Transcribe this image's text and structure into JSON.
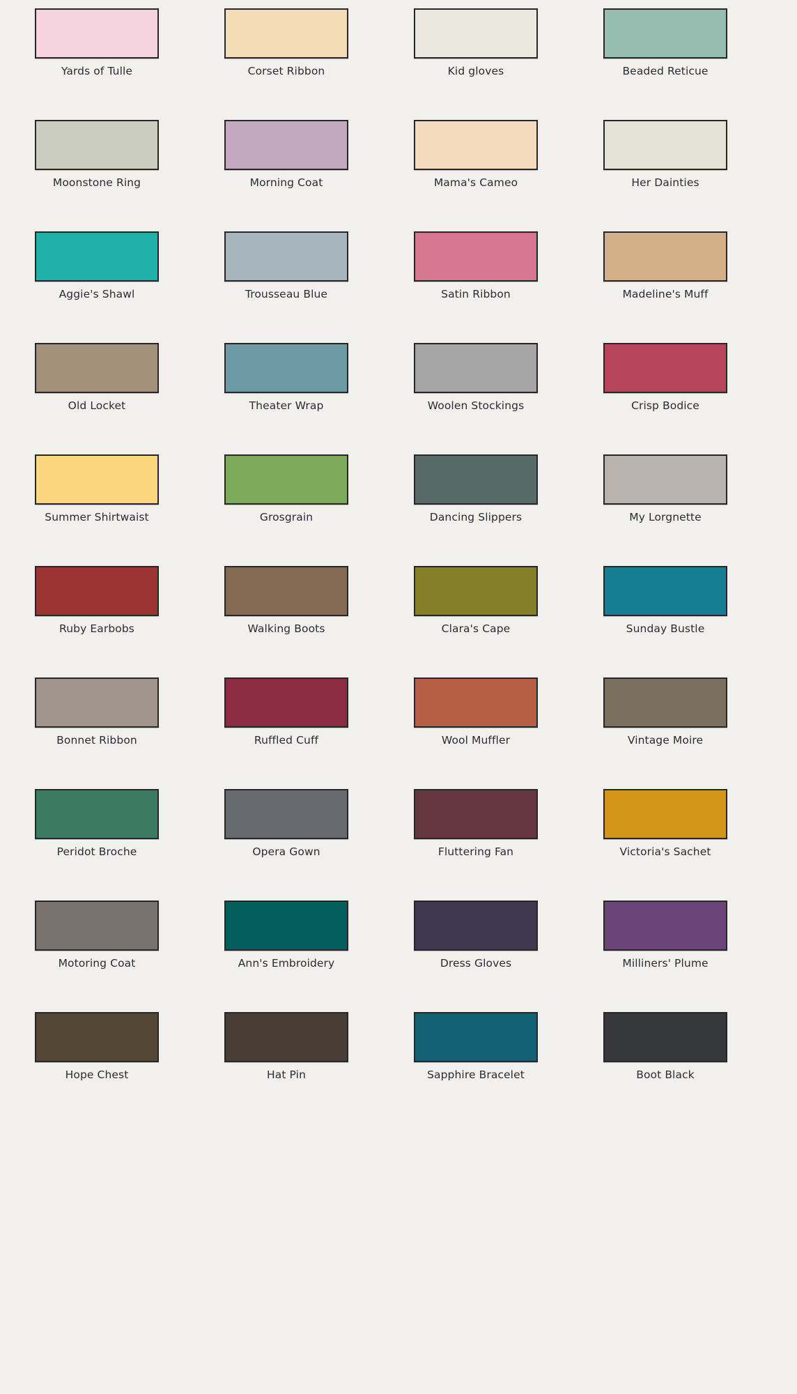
{
  "page": {
    "background_color": "#f2f0ec",
    "label_color": "#2b2b33",
    "swatch_border_color": "#26262b",
    "columns": 4,
    "rows": 10,
    "swatch_count": 40
  },
  "swatches": [
    {
      "name": "Yards of Tulle",
      "hex": "#f5d2dd"
    },
    {
      "name": "Corset Ribbon",
      "hex": "#f3ddb7"
    },
    {
      "name": "Kid gloves",
      "hex": "#eae8de"
    },
    {
      "name": "Beaded Reticue",
      "hex": "#96bdb0"
    },
    {
      "name": "Moonstone Ring",
      "hex": "#cbcdbe"
    },
    {
      "name": "Morning Coat",
      "hex": "#c4a8bf"
    },
    {
      "name": "Mama's Cameo",
      "hex": "#f4dabd"
    },
    {
      "name": "Her Dainties",
      "hex": "#e4e2d4"
    },
    {
      "name": "Aggie's Shawl",
      "hex": "#20b2aa"
    },
    {
      "name": "Trousseau Blue",
      "hex": "#a7b6bc"
    },
    {
      "name": "Satin Ribbon",
      "hex": "#d5778f"
    },
    {
      "name": "Madeline's Muff",
      "hex": "#d4b088"
    },
    {
      "name": "Old Locket",
      "hex": "#a2907a"
    },
    {
      "name": "Theater Wrap",
      "hex": "#6d9aa5"
    },
    {
      "name": "Woolen Stockings",
      "hex": "#a5a5a5"
    },
    {
      "name": "Crisp Bodice",
      "hex": "#b8455c"
    },
    {
      "name": "Summer Shirtwaist",
      "hex": "#fcd67e"
    },
    {
      "name": "Grosgrain",
      "hex": "#7cac5b"
    },
    {
      "name": "Dancing Slippers",
      "hex": "#566a68"
    },
    {
      "name": "My Lorgnette",
      "hex": "#bab3ad"
    },
    {
      "name": "Ruby Earbobs",
      "hex": "#9c3434"
    },
    {
      "name": "Walking Boots",
      "hex": "#846a50"
    },
    {
      "name": "Clara's Cape",
      "hex": "#857f2a"
    },
    {
      "name": "Sunday Bustle",
      "hex": "#177d92"
    },
    {
      "name": "Bonnet Ribbon",
      "hex": "#a1958c"
    },
    {
      "name": "Ruffled Cuff",
      "hex": "#8b2c43"
    },
    {
      "name": "Wool Muffler",
      "hex": "#b55f47"
    },
    {
      "name": "Vintage Moire",
      "hex": "#7b7060"
    },
    {
      "name": "Peridot Broche",
      "hex": "#3b7a63"
    },
    {
      "name": "Opera Gown",
      "hex": "#66696e"
    },
    {
      "name": "Fluttering Fan",
      "hex": "#653840"
    },
    {
      "name": "Victoria's Sachet",
      "hex": "#d29518"
    },
    {
      "name": "Motoring Coat",
      "hex": "#7a726d"
    },
    {
      "name": "Ann's Embroidery",
      "hex": "#045f5c"
    },
    {
      "name": "Dress Gloves",
      "hex": "#3e3950"
    },
    {
      "name": "Milliners' Plume",
      "hex": "#6b4478"
    },
    {
      "name": "Hope Chest",
      "hex": "#554736"
    },
    {
      "name": "Hat Pin",
      "hex": "#493e36"
    },
    {
      "name": "Sapphire Bracelet",
      "hex": "#146174"
    },
    {
      "name": "Boot Black",
      "hex": "#36383a"
    }
  ]
}
